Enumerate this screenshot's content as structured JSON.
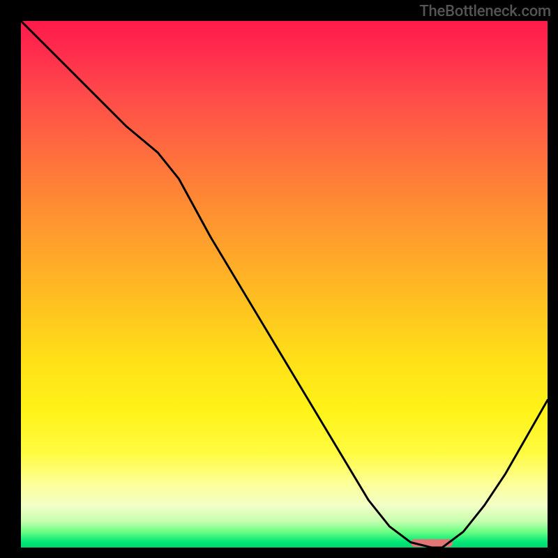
{
  "watermark": "TheBottleneck.com",
  "chart_data": {
    "type": "line",
    "title": "",
    "xlabel": "",
    "ylabel": "",
    "xlim": [
      0,
      100
    ],
    "ylim": [
      0,
      100
    ],
    "series": [
      {
        "name": "bottleneck-curve",
        "x": [
          0,
          7,
          14,
          20,
          26,
          30,
          36,
          42,
          48,
          54,
          60,
          66,
          70,
          74,
          78,
          80,
          84,
          88,
          92,
          96,
          100
        ],
        "values": [
          100,
          93,
          86,
          80,
          75,
          70,
          59,
          49,
          39,
          29,
          19,
          9,
          4,
          1,
          0,
          0,
          3,
          8,
          14,
          21,
          28
        ]
      }
    ],
    "optimal_range": {
      "start": 74,
      "end": 82
    }
  },
  "colors": {
    "curve": "#000000",
    "marker": "#e27676",
    "bg_black": "#000000"
  }
}
